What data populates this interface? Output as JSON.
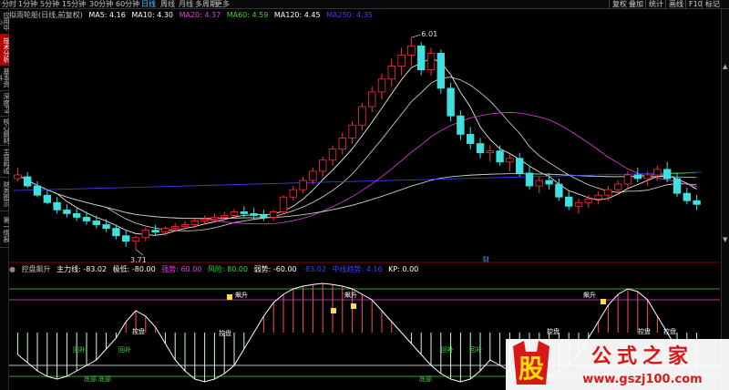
{
  "toolbar": {
    "periods": [
      "分时",
      "1分钟",
      "5分钟",
      "15分钟",
      "30分钟",
      "60分钟",
      "日线",
      "周线",
      "月线",
      "多周期",
      "更多"
    ],
    "active_period": "日线",
    "buttons": [
      "复权",
      "叠加",
      "统计",
      "画线",
      "F10",
      "标记"
    ]
  },
  "sidebar": {
    "tabs": [
      "应用中心",
      "技术分析",
      "基本资料",
      "深度F9",
      "核心题材",
      "主营构成",
      "财务图示",
      "第一情报"
    ],
    "active": "技术分析"
  },
  "main_legend": {
    "name": "拟雨轮船(日线,前复权)",
    "ma5": {
      "label": "MA5: 4.16",
      "color": "#ffffff"
    },
    "ma10": {
      "label": "MA10: 4.30",
      "color": "#ffffff"
    },
    "ma20": {
      "label": "MA20: 4.37",
      "color": "#e040e0"
    },
    "ma60": {
      "label": "MA60: 4.59",
      "color": "#40d040"
    },
    "ma120": {
      "label": "MA120: 4.45",
      "color": "#ffffff"
    },
    "ma250": {
      "label": "MA250: 4.35",
      "color": "#4040ff"
    }
  },
  "annotations": {
    "high": "6.01",
    "low": "3.71",
    "marker": "财"
  },
  "indicator_legend": {
    "name": "控盘飙升",
    "main": {
      "label": "主力线: -83.02",
      "color": "#ffffff"
    },
    "bottom": {
      "label": "极低: -80.00",
      "color": "#ffffff"
    },
    "strong": {
      "label": "强势: 60.00",
      "color": "#e040e0"
    },
    "risk": {
      "label": "风险: 80.00",
      "color": "#40d040"
    },
    "weak": {
      "label": "弱势: -60.00",
      "color": "#ffffff"
    },
    "v1": {
      "label": "-83.02",
      "color": "#4040ff"
    },
    "v2": {
      "label": "中线趋势: 4.16",
      "color": "#4040ff"
    },
    "kp": {
      "label": "KP: 0.00",
      "color": "#ffffff"
    }
  },
  "indicator_labels": {
    "kongpan": "控盘",
    "huibu": "回补",
    "bottom_tag": "底部",
    "rise": "飙升"
  },
  "watermark": {
    "char": "股",
    "title": "公式之家",
    "url": "www.gszj100.com"
  },
  "chart_data": {
    "type": "candlestick",
    "candles": [
      [
        4.48,
        4.6,
        4.45,
        4.52
      ],
      [
        4.5,
        4.55,
        4.38,
        4.4
      ],
      [
        4.4,
        4.45,
        4.28,
        4.3
      ],
      [
        4.3,
        4.36,
        4.2,
        4.22
      ],
      [
        4.22,
        4.28,
        4.1,
        4.14
      ],
      [
        4.14,
        4.2,
        4.06,
        4.1
      ],
      [
        4.1,
        4.16,
        4.02,
        4.06
      ],
      [
        4.06,
        4.12,
        3.98,
        4.02
      ],
      [
        4.02,
        4.08,
        3.94,
        3.98
      ],
      [
        3.98,
        4.04,
        3.9,
        3.94
      ],
      [
        3.94,
        3.98,
        3.82,
        3.86
      ],
      [
        3.86,
        3.92,
        3.74,
        3.8
      ],
      [
        3.8,
        3.86,
        3.71,
        3.84
      ],
      [
        3.84,
        3.95,
        3.8,
        3.92
      ],
      [
        3.92,
        3.98,
        3.86,
        3.9
      ],
      [
        3.9,
        3.96,
        3.86,
        3.94
      ],
      [
        3.94,
        4.0,
        3.9,
        3.96
      ],
      [
        3.96,
        4.02,
        3.92,
        3.98
      ],
      [
        3.98,
        4.05,
        3.94,
        4.02
      ],
      [
        4.02,
        4.08,
        3.98,
        4.04
      ],
      [
        4.04,
        4.1,
        4.0,
        4.06
      ],
      [
        4.06,
        4.12,
        4.02,
        4.08
      ],
      [
        4.08,
        4.15,
        4.04,
        4.12
      ],
      [
        4.12,
        4.18,
        4.06,
        4.1
      ],
      [
        4.1,
        4.16,
        4.04,
        4.08
      ],
      [
        4.08,
        4.14,
        4.02,
        4.06
      ],
      [
        4.06,
        4.14,
        4.02,
        4.12
      ],
      [
        4.12,
        4.3,
        4.1,
        4.28
      ],
      [
        4.28,
        4.4,
        4.24,
        4.36
      ],
      [
        4.36,
        4.5,
        4.32,
        4.46
      ],
      [
        4.46,
        4.6,
        4.42,
        4.56
      ],
      [
        4.56,
        4.72,
        4.5,
        4.68
      ],
      [
        4.68,
        4.84,
        4.62,
        4.8
      ],
      [
        4.8,
        4.98,
        4.74,
        4.92
      ],
      [
        4.92,
        5.1,
        4.86,
        5.06
      ],
      [
        5.06,
        5.3,
        5.0,
        5.26
      ],
      [
        5.26,
        5.48,
        5.2,
        5.42
      ],
      [
        5.42,
        5.62,
        5.34,
        5.56
      ],
      [
        5.56,
        5.78,
        5.48,
        5.7
      ],
      [
        5.7,
        5.9,
        5.6,
        5.82
      ],
      [
        5.82,
        6.01,
        5.7,
        5.92
      ],
      [
        5.92,
        5.96,
        5.6,
        5.66
      ],
      [
        5.66,
        5.9,
        5.6,
        5.84
      ],
      [
        5.84,
        5.88,
        5.4,
        5.46
      ],
      [
        5.46,
        5.52,
        5.1,
        5.16
      ],
      [
        5.16,
        5.22,
        4.9,
        4.96
      ],
      [
        4.96,
        5.04,
        4.8,
        4.86
      ],
      [
        4.86,
        4.92,
        4.7,
        4.76
      ],
      [
        4.76,
        4.84,
        4.66,
        4.78
      ],
      [
        4.78,
        4.84,
        4.62,
        4.66
      ],
      [
        4.66,
        4.74,
        4.56,
        4.7
      ],
      [
        4.7,
        4.76,
        4.5,
        4.54
      ],
      [
        4.54,
        4.62,
        4.36,
        4.4
      ],
      [
        4.4,
        4.5,
        4.32,
        4.46
      ],
      [
        4.46,
        4.54,
        4.36,
        4.42
      ],
      [
        4.42,
        4.48,
        4.24,
        4.28
      ],
      [
        4.28,
        4.34,
        4.14,
        4.18
      ],
      [
        4.18,
        4.26,
        4.1,
        4.22
      ],
      [
        4.22,
        4.3,
        4.16,
        4.26
      ],
      [
        4.26,
        4.34,
        4.2,
        4.3
      ],
      [
        4.3,
        4.4,
        4.24,
        4.36
      ],
      [
        4.36,
        4.46,
        4.3,
        4.42
      ],
      [
        4.42,
        4.56,
        4.38,
        4.52
      ],
      [
        4.52,
        4.6,
        4.44,
        4.48
      ],
      [
        4.48,
        4.56,
        4.4,
        4.52
      ],
      [
        4.52,
        4.62,
        4.46,
        4.58
      ],
      [
        4.58,
        4.66,
        4.44,
        4.48
      ],
      [
        4.48,
        4.54,
        4.28,
        4.32
      ],
      [
        4.32,
        4.38,
        4.2,
        4.24
      ],
      [
        4.24,
        4.3,
        4.14,
        4.2
      ]
    ],
    "ylim": [
      3.6,
      6.2
    ],
    "indicator": {
      "main_line": [
        -40,
        -55,
        -70,
        -80,
        -85,
        -80,
        -70,
        -60,
        -50,
        -30,
        -10,
        20,
        40,
        30,
        10,
        -20,
        -50,
        -70,
        -85,
        -90,
        -85,
        -75,
        -60,
        -30,
        0,
        30,
        55,
        70,
        80,
        85,
        88,
        90,
        88,
        85,
        80,
        70,
        60,
        40,
        20,
        0,
        -20,
        -40,
        -60,
        -75,
        -85,
        -90,
        -85,
        -70,
        -50,
        -60,
        -70,
        -80,
        -85,
        -88,
        -80,
        -70,
        -60,
        -40,
        -10,
        20,
        50,
        70,
        80,
        75,
        60,
        30,
        0,
        -30,
        -60,
        -83
      ],
      "lines": {
        "risk": 80,
        "strong": 60,
        "weak": -60,
        "bottom": -80
      },
      "ylim": [
        -100,
        100
      ]
    }
  }
}
